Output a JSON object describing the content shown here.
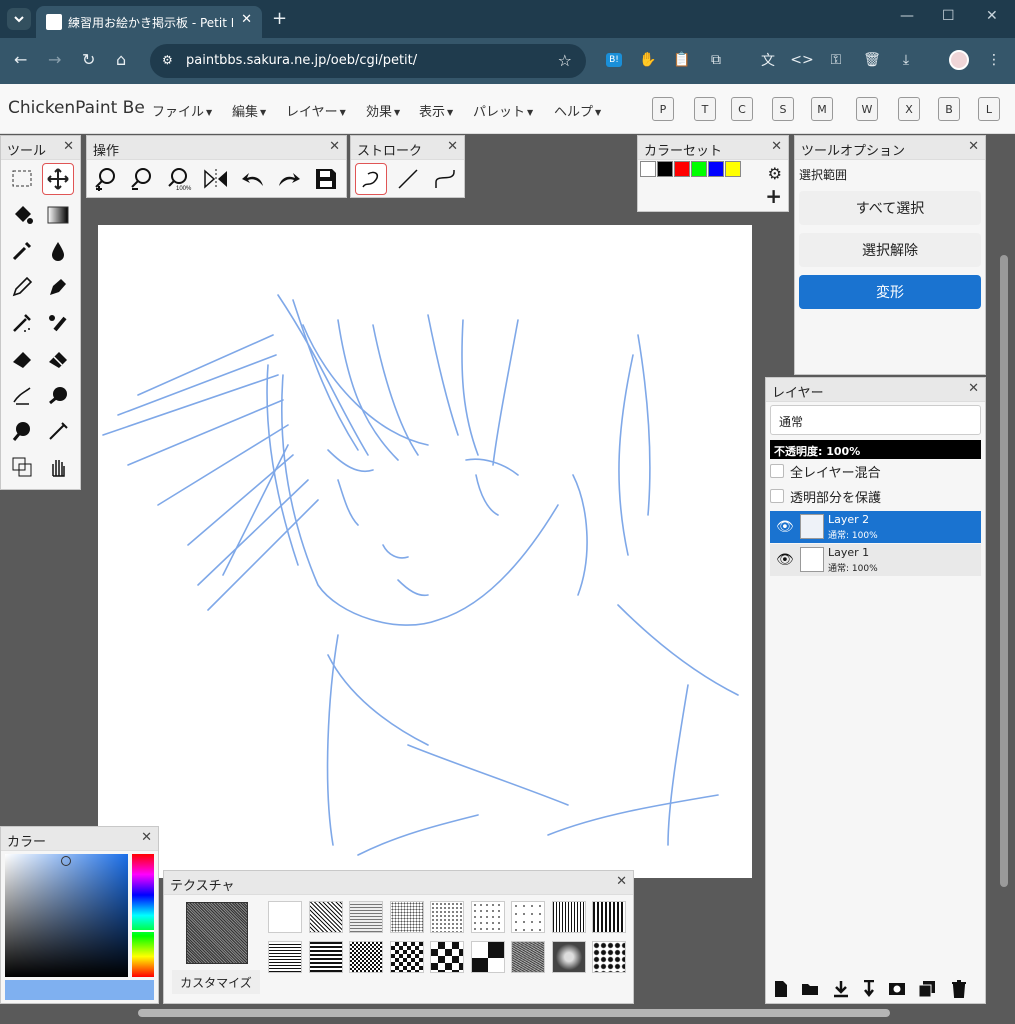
{
  "browser": {
    "tab_title": "練習用お絵かき掲示板 - Petit No",
    "url": "paintbbs.sakura.ne.jp/oeb/cgi/petit/"
  },
  "app": {
    "title": "ChickenPaint Be",
    "menus": [
      "ファイル",
      "編集",
      "レイヤー",
      "効果",
      "表示",
      "パレット",
      "ヘルプ"
    ],
    "palette_buttons": [
      "P",
      "T",
      "C",
      "S",
      "M",
      "W",
      "X",
      "B",
      "L"
    ]
  },
  "panels": {
    "tools": {
      "title": "ツール"
    },
    "ops": {
      "title": "操作"
    },
    "stroke": {
      "title": "ストローク"
    },
    "colorset": {
      "title": "カラーセット",
      "swatches": [
        "#ffffff",
        "#000000",
        "#ff0000",
        "#00ff00",
        "#0000ff",
        "#ffff00"
      ]
    },
    "tool_options": {
      "title": "ツールオプション",
      "label": "選択範囲",
      "select_all": "すべて選択",
      "deselect": "選択解除",
      "transform": "変形"
    },
    "layers": {
      "title": "レイヤー",
      "blend_mode": "通常",
      "opacity": "不透明度: 100%",
      "sample_all": "全レイヤー混合",
      "protect_alpha": "透明部分を保護",
      "items": [
        {
          "name": "Layer 2",
          "mode": "通常: 100%",
          "selected": true
        },
        {
          "name": "Layer 1",
          "mode": "通常: 100%",
          "selected": false
        }
      ]
    },
    "color": {
      "title": "カラー",
      "current": "#7fb0f0"
    },
    "texture": {
      "title": "テクスチャ",
      "customize": "カスタマイズ"
    }
  },
  "colors": {
    "accent": "#1a73d0",
    "sketch": "#7fa8e8"
  }
}
